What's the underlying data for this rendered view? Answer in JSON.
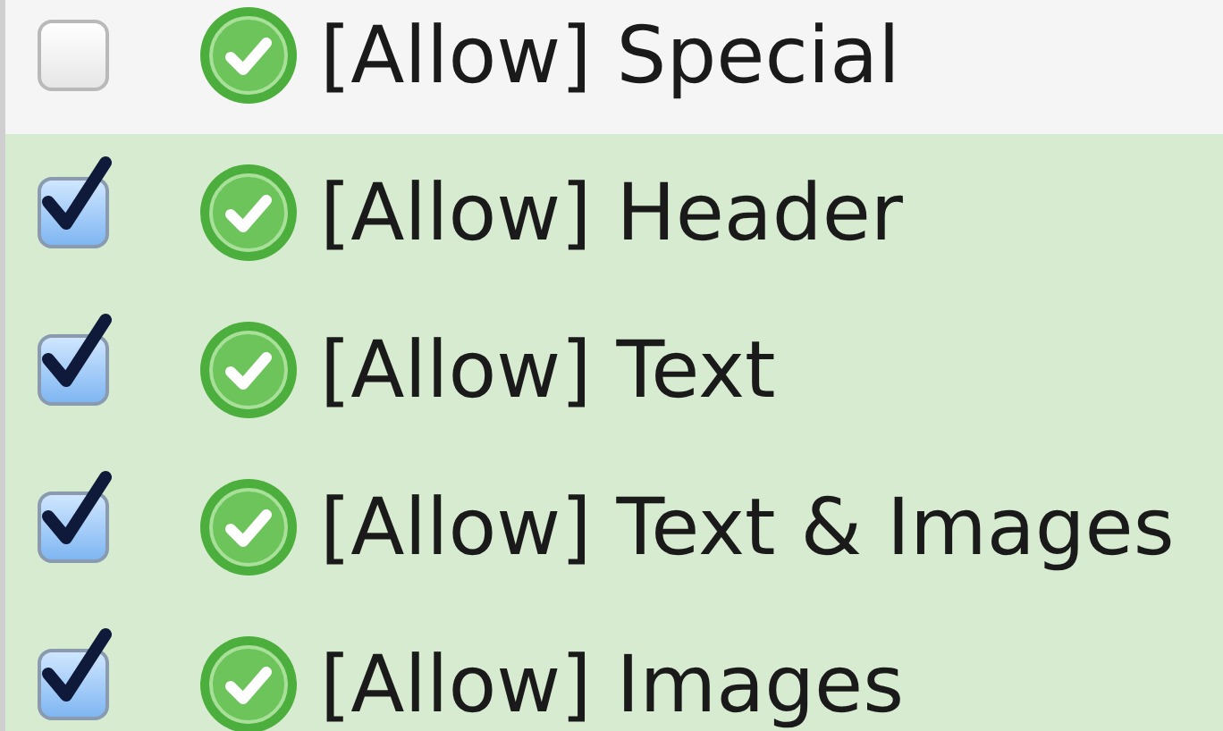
{
  "items": [
    {
      "label": "[Allow] Special",
      "checked": false
    },
    {
      "label": "[Allow] Header",
      "checked": true
    },
    {
      "label": "[Allow] Text",
      "checked": true
    },
    {
      "label": "[Allow] Text & Images",
      "checked": true
    },
    {
      "label": "[Allow] Images",
      "checked": true
    }
  ]
}
